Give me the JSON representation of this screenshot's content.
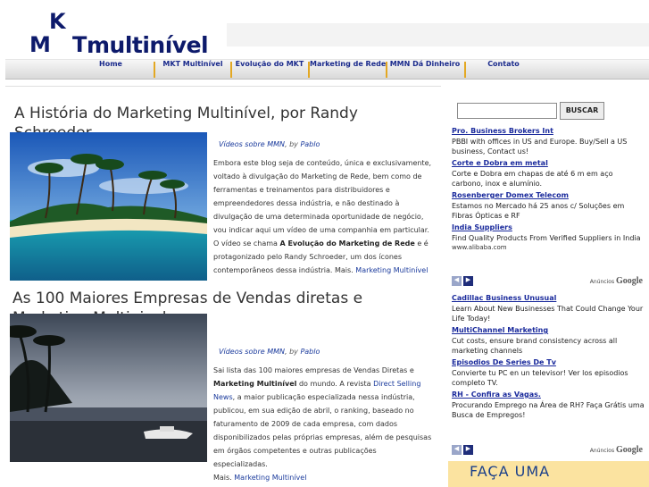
{
  "logo": {
    "k": "K",
    "m": "M",
    "t": "T",
    "word": "multinível"
  },
  "nav": {
    "items": [
      "Home",
      "MKT Multinível",
      "Evolução do MKT",
      "Marketing de Rede",
      "MMN Dá Dinheiro",
      "Contato"
    ]
  },
  "posts": [
    {
      "title": "A História do Marketing Multinível, por Randy Schroeder",
      "meta_cat": "Vídeos sobre MMN",
      "meta_by": ", by ",
      "meta_author": "Pablo",
      "body_1": "Embora este blog seja de conteúdo, única e exclusivamente, voltado à divulgação do Marketing de Rede, bem como de ferramentas e treinamentos para distribuidores e empreendedores dessa indústria, e não destinado à divulgação de uma determinada oportunidade de negócio, vou indicar aqui um vídeo de uma companhia em particular. O vídeo se chama ",
      "body_bold": "A Evolução do Marketing de Rede",
      "body_2": " e é protagonizado pelo Randy Schroeder, um dos ícones contemporâneos dessa indústria. Mais. ",
      "more_link": "Marketing Multinível"
    },
    {
      "title_1": "As 100 Maiores Empresas de Vendas diretas e",
      "title_2": "Marketing Multinivel",
      "meta_cat": "Vídeos sobre MMN",
      "meta_by": ", by ",
      "meta_author": "Pablo",
      "body_1": "Sai lista das 100 maiores empresas de Vendas Diretas e ",
      "body_bold": "Marketing Multinível",
      "body_2": " do mundo. A revista ",
      "body_link": "Direct Selling News",
      "body_3": ", a maior publicação especializada nessa indústria, publicou, em sua edição de abril, o ranking, baseado no faturamento de 2009 de cada empresa, com dados disponibilizados pelas  próprias empresas, além de pesquisas em órgãos competentes e outras publicações especializadas.",
      "more_prefix": "Mais. ",
      "more_link": "Marketing Multinível"
    }
  ],
  "search": {
    "button": "BUSCAR",
    "value": ""
  },
  "ads_1": [
    {
      "title": "Pro. Business Brokers Int",
      "desc": "PBBI with offices in US and Europe. Buy/Sell a US business, Contact us!"
    },
    {
      "title": "Corte e Dobra em metal",
      "desc": "Corte e Dobra em chapas de até 6 m em aço carbono, inox e alumínio."
    },
    {
      "title": "Rosenberger Domex Telecom",
      "desc": "Estamos no Mercado há 25 anos c/ Soluções em Fibras Ópticas e RF"
    },
    {
      "title": "India Suppliers",
      "desc": "Find Quality Products From Verified Suppliers in India",
      "url": "www.alibaba.com"
    }
  ],
  "ads_2": [
    {
      "title": "Cadillac Business Unusual",
      "desc": "Learn About New Businesses That Could Change Your Life Today!"
    },
    {
      "title": "MultiChannel Marketing",
      "desc": "Cut costs, ensure brand consistency across all marketing channels"
    },
    {
      "title": "Episodios De Series De Tv",
      "desc": "Convierte tu PC en un televisor! Ver los episodios completo TV."
    },
    {
      "title": "RH - Confira as Vagas.",
      "desc": "Procurando Emprego na Área de RH? Faça Grátis uma Busca de Empregos!"
    }
  ],
  "ads_footer": {
    "label": "Anúncios",
    "brand": "Google",
    "prev": "◀",
    "next": "▶"
  },
  "banner": {
    "text": "FAÇA UMA"
  },
  "colors": {
    "brand": "#0d1a6b",
    "link": "#1a3a9c",
    "nav_sep": "#e3a823"
  }
}
